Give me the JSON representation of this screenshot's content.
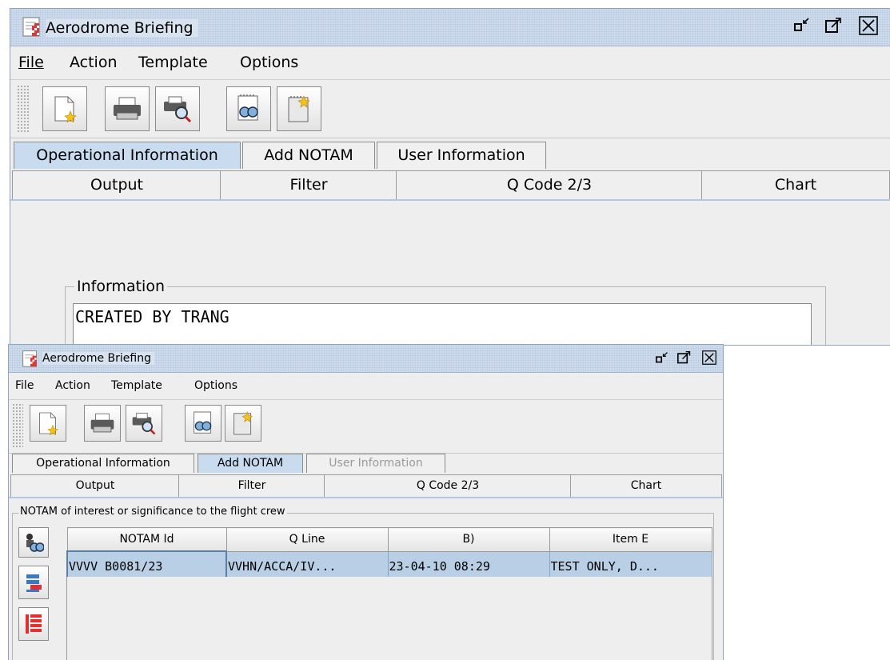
{
  "window": {
    "title": "Aerodrome Briefing",
    "controls": {
      "restore": "restore-icon",
      "maximize": "maximize-icon",
      "close": "close-icon"
    }
  },
  "menu": [
    "File",
    "Action",
    "Template",
    "Options"
  ],
  "toolbar": {
    "buttons": [
      "new-document-icon",
      "print-icon",
      "print-preview-icon",
      "find-icon",
      "new-notam-icon"
    ]
  },
  "tabs": [
    "Operational Information",
    "Add NOTAM",
    "User Information"
  ],
  "subtabs": [
    "Output",
    "Filter",
    "Q Code 2/3",
    "Chart"
  ],
  "back_window": {
    "active_tab": "Operational Information",
    "information_label": "Information",
    "information_text": "CREATED BY TRANG"
  },
  "front_window": {
    "active_tab": "Add NOTAM",
    "disabled_tab": "User Information",
    "group_label": "NOTAM of interest or significance to the flight crew",
    "table": {
      "columns": [
        "NOTAM Id",
        "Q Line",
        "B)",
        "Item E"
      ],
      "rows": [
        [
          "VVVV B0081/23",
          "VVHN/ACCA/IV...",
          "23-04-10 08:29",
          "TEST ONLY, D..."
        ]
      ]
    },
    "side_buttons": [
      "search-notam-icon",
      "select-row-icon",
      "list-icon"
    ]
  },
  "colors": {
    "active_tab": "#c9dbef",
    "selected_row": "#b8cfe5",
    "accent": "#b0c8e6"
  }
}
